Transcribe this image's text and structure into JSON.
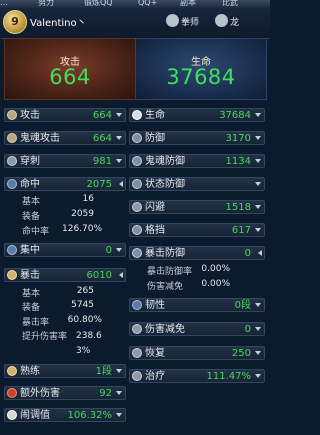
{
  "tabs": [
    "…",
    "努力",
    "锻炼QQ",
    "QQ+",
    "副本",
    "比武"
  ],
  "header": {
    "level": "9",
    "player_name": "Valentino丶",
    "class_label": "拳师",
    "mount_label": "龙"
  },
  "summary": {
    "attack": {
      "label": "攻击",
      "value": "664"
    },
    "hp": {
      "label": "生命",
      "value": "37684"
    }
  },
  "left_stats": {
    "attack": {
      "label": "攻击",
      "value": "664"
    },
    "ghost_attack": {
      "label": "鬼魂攻击",
      "value": "664"
    },
    "pierce": {
      "label": "穿刺",
      "value": "981"
    },
    "hit": {
      "label": "命中",
      "value": "2075",
      "details": [
        {
          "label": "基本",
          "value": "16"
        },
        {
          "label": "装备",
          "value": "2059"
        },
        {
          "label": "命中率",
          "value": "126.70%"
        }
      ]
    },
    "focus": {
      "label": "集中",
      "value": "0"
    },
    "crit": {
      "label": "暴击",
      "value": "6010",
      "details": [
        {
          "label": "基本",
          "value": "265"
        },
        {
          "label": "装备",
          "value": "5745"
        },
        {
          "label": "暴击率",
          "value": "60.80%"
        },
        {
          "label": "提升伤害率",
          "value": "238.63%"
        }
      ]
    },
    "proficiency": {
      "label": "熟练",
      "value": "1段"
    },
    "extra_damage": {
      "label": "额外伤害",
      "value": "92"
    },
    "chaos": {
      "label": "闹调值",
      "value": "106.32%"
    }
  },
  "right_stats": {
    "hp": {
      "label": "生命",
      "value": "37684"
    },
    "defense": {
      "label": "防御",
      "value": "3170"
    },
    "ghost_defense": {
      "label": "鬼魂防御",
      "value": "1134"
    },
    "status_defense": {
      "label": "状态防御",
      "value": ""
    },
    "evade": {
      "label": "闪避",
      "value": "1518"
    },
    "block": {
      "label": "格挡",
      "value": "617"
    },
    "crit_defense": {
      "label": "暴击防御",
      "value": "0",
      "details": [
        {
          "label": "暴击防御率",
          "value": "0.00%"
        },
        {
          "label": "伤害减免",
          "value": "0.00%"
        }
      ]
    },
    "toughness": {
      "label": "韧性",
      "value": "0段"
    },
    "damage_reduction": {
      "label": "伤害减免",
      "value": "0"
    },
    "recovery": {
      "label": "恢复",
      "value": "250"
    },
    "healing": {
      "label": "治疗",
      "value": "111.47%"
    }
  }
}
